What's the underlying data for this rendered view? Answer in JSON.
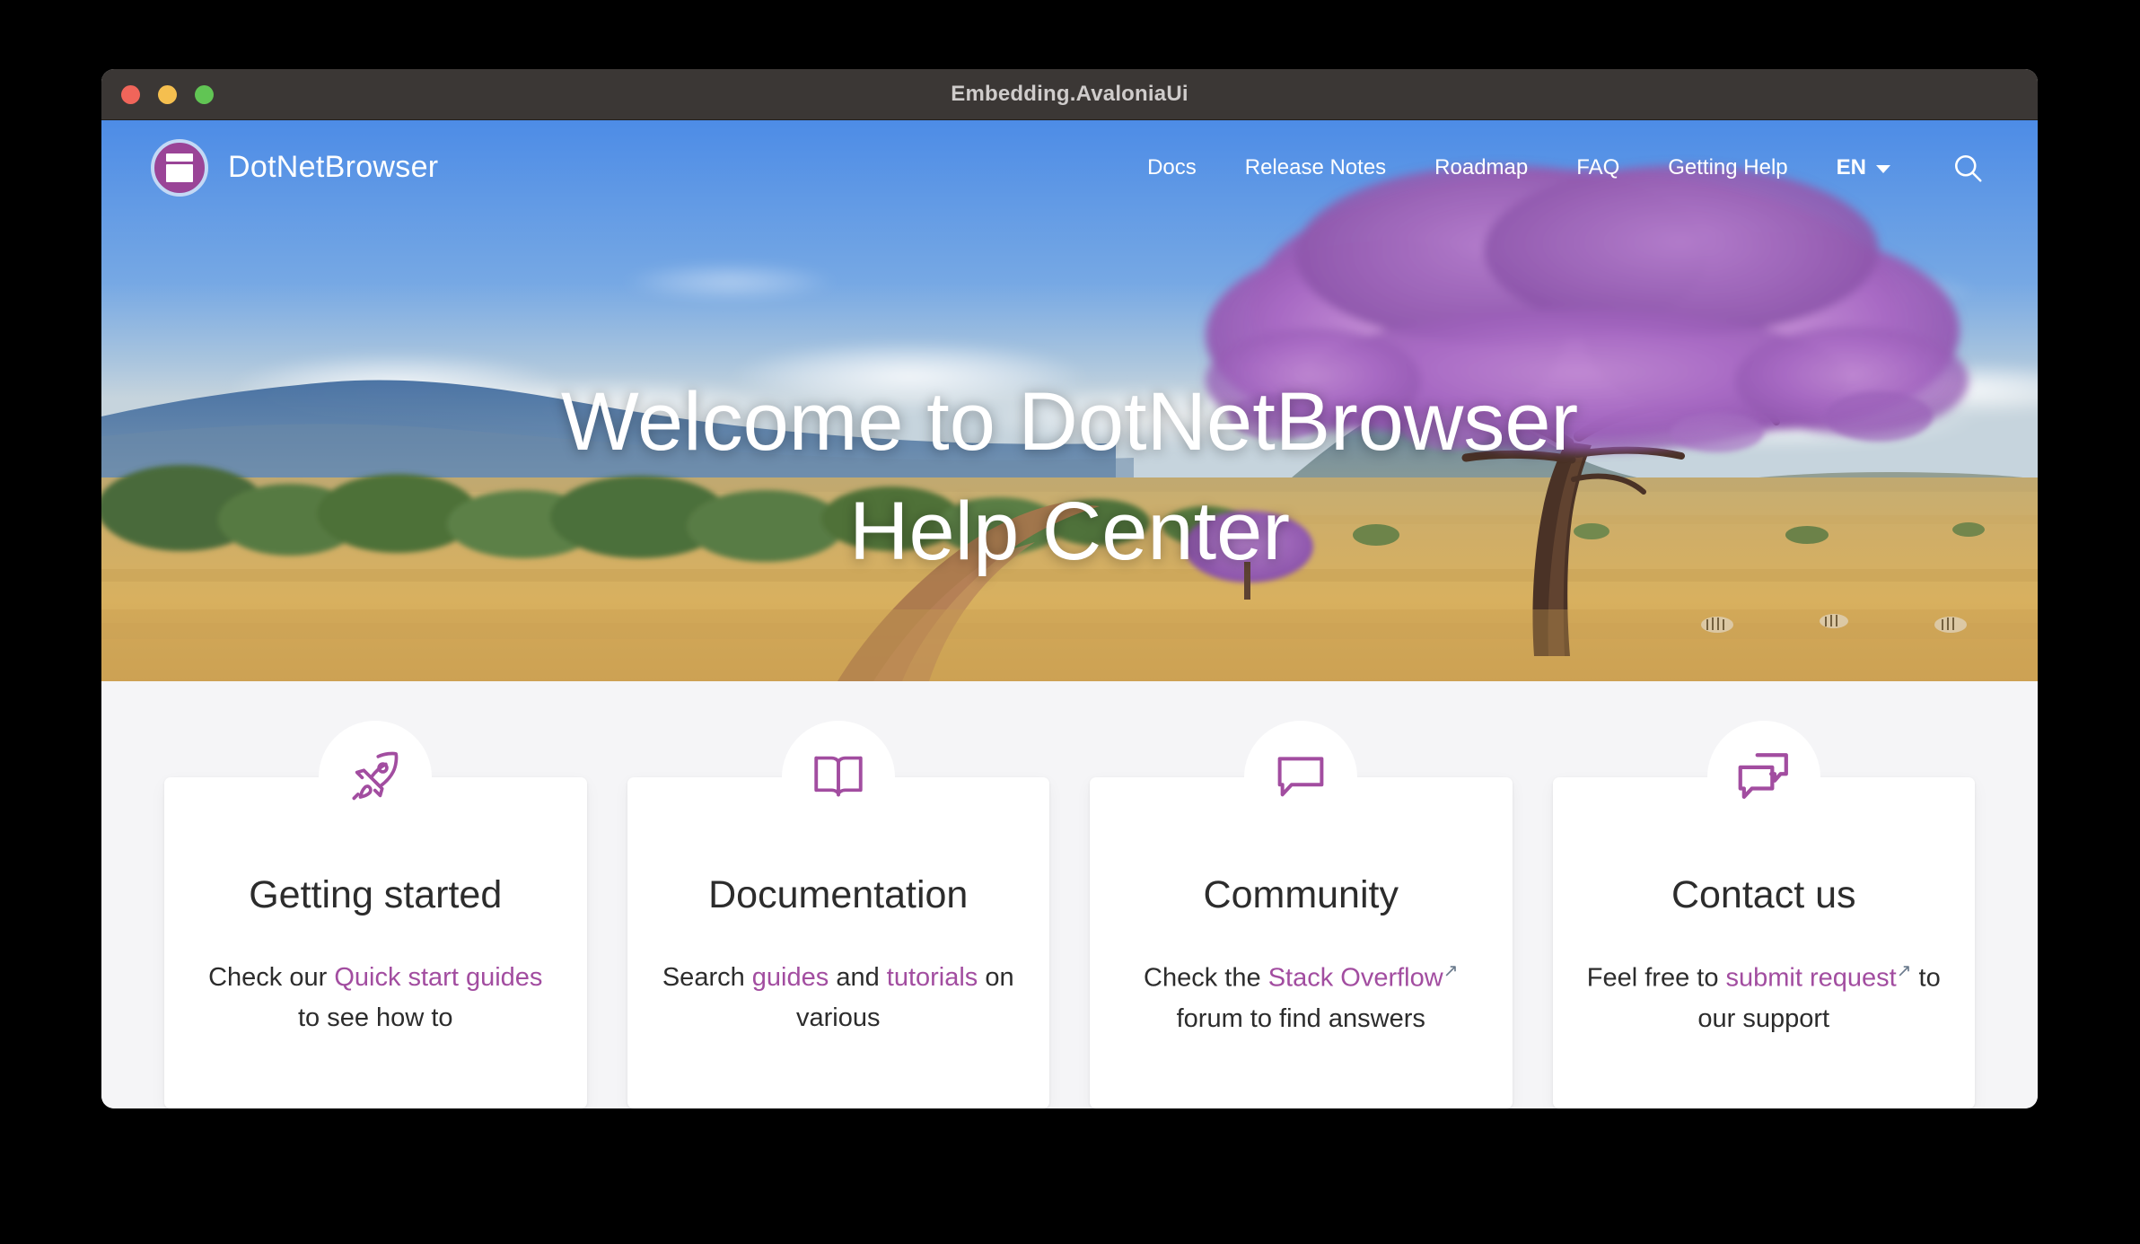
{
  "window": {
    "title": "Embedding.AvaloniaUi",
    "traffic_lights": [
      "close",
      "minimize",
      "maximize"
    ]
  },
  "site": {
    "brand": {
      "name": "DotNetBrowser",
      "logo_icon": "browser-window-logo-icon",
      "logo_color": "#9a4497",
      "logo_ring_color": "#c3d9f5"
    },
    "nav": {
      "links": [
        {
          "label": "Docs"
        },
        {
          "label": "Release Notes"
        },
        {
          "label": "Roadmap"
        },
        {
          "label": "FAQ"
        },
        {
          "label": "Getting Help"
        }
      ],
      "language": "EN",
      "language_caret_icon": "chevron-down-icon",
      "search_icon": "search-icon"
    },
    "hero": {
      "title_line1": "Welcome to DotNetBrowser",
      "title_line2": "Help Center",
      "background": "savanna-jacaranda-tree-photo",
      "sky_color": "#5b96e8",
      "grass_color": "#cfa košice"
    },
    "accent_color": "#a24da0",
    "page_background": "#f5f5f7",
    "cards": [
      {
        "icon": "rocket-icon",
        "title": "Getting started",
        "desc_parts": [
          {
            "text": "Check our ",
            "link": false
          },
          {
            "text": "Quick start guides",
            "link": true
          },
          {
            "text": " to see how to",
            "link": false
          }
        ]
      },
      {
        "icon": "open-book-icon",
        "title": "Documentation",
        "desc_parts": [
          {
            "text": "Search ",
            "link": false
          },
          {
            "text": "guides",
            "link": true
          },
          {
            "text": " and ",
            "link": false
          },
          {
            "text": "tutorials",
            "link": true
          },
          {
            "text": " on various",
            "link": false
          }
        ]
      },
      {
        "icon": "speech-bubble-icon",
        "title": "Community",
        "desc_parts": [
          {
            "text": "Check the ",
            "link": false
          },
          {
            "text": "Stack Overflow",
            "link": true,
            "external": true
          },
          {
            "text": " forum to find answers",
            "link": false
          }
        ]
      },
      {
        "icon": "two-speech-bubbles-icon",
        "title": "Contact us",
        "desc_parts": [
          {
            "text": "Feel free to ",
            "link": false
          },
          {
            "text": "submit request",
            "link": true,
            "external": true
          },
          {
            "text": " to our support",
            "link": false
          }
        ]
      }
    ]
  }
}
